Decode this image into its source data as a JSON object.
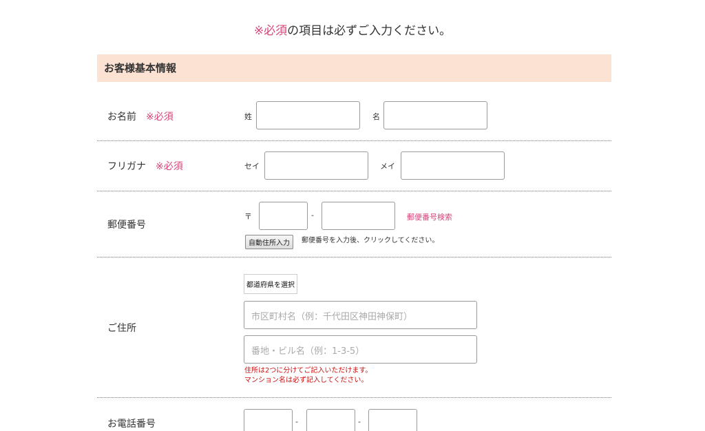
{
  "notice": {
    "required_mark": "※必須",
    "text": "の項目は必ずご入力ください。"
  },
  "section": {
    "title": "お客様基本情報"
  },
  "name_row": {
    "label": "お名前",
    "required": "※必須",
    "last_label": "姓",
    "first_label": "名"
  },
  "kana_row": {
    "label": "フリガナ",
    "required": "※必須",
    "last_label": "セイ",
    "first_label": "メイ"
  },
  "zip_row": {
    "label": "郵便番号",
    "symbol": "〒",
    "separator": "-",
    "search_link": "郵便番号検索",
    "auto_button": "自動住所入力",
    "hint": "郵便番号を入力後、クリックしてください。"
  },
  "address_row": {
    "label": "ご住所",
    "prefecture_select": "都道府県を選択",
    "city_placeholder": "市区町村名（例：千代田区神田神保町）",
    "street_placeholder": "番地・ビル名（例：1-3-5）",
    "note_line1": "住所は2つに分けてご記入いただけます。",
    "note_line2": "マンション名は必ず記入してください。"
  },
  "phone_row": {
    "label": "お電話番号",
    "separator": "-"
  },
  "colors": {
    "required": "#d6457a",
    "section_bg": "#fbe2d2",
    "warning": "#cc1111"
  }
}
